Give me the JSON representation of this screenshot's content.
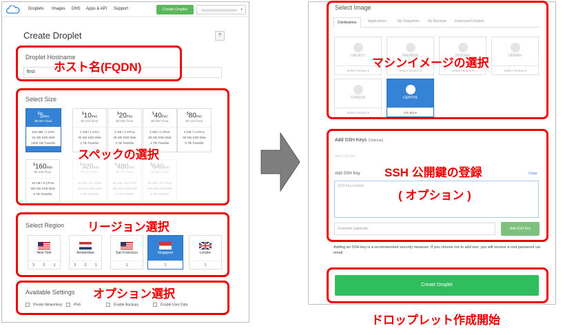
{
  "nav": {
    "items": [
      "Droplets",
      "Images",
      "DNS",
      "Apps & API",
      "Support"
    ],
    "create_button": "Create Droplet"
  },
  "page_title": "Create Droplet",
  "help_label": "?",
  "hostname": {
    "label": "Droplet Hostname",
    "value": "first"
  },
  "size": {
    "label": "Select Size",
    "plans": [
      {
        "price": "5",
        "hourly": "$0.007",
        "specs": [
          "512 MB / 1 CPU",
          "20 GB SSD Disk",
          "1000 GB Transfer"
        ]
      },
      {
        "price": "10",
        "hourly": "$0.015",
        "specs": [
          "1 GB / 1 CPU",
          "30 GB SSD Disk",
          "2 TB Transfer"
        ]
      },
      {
        "price": "20",
        "hourly": "$0.030",
        "specs": [
          "2 GB / 2 CPUs",
          "40 GB SSD Disk",
          "3 TB Transfer"
        ]
      },
      {
        "price": "40",
        "hourly": "$0.060",
        "specs": [
          "4 GB / 2 CPUs",
          "60 GB SSD Disk",
          "4 TB Transfer"
        ]
      },
      {
        "price": "80",
        "hourly": "$0.119",
        "specs": [
          "8 GB / 4 CPUs",
          "80 GB SSD Disk",
          "5 TB Transfer"
        ]
      },
      {
        "price": "160",
        "hourly": "$0.238",
        "specs": [
          "16 GB / 8 CPUs",
          "160 GB SSD Disk",
          "6 TB Transfer"
        ]
      },
      {
        "price": "320",
        "hourly": "$0.476",
        "specs": [
          "32 GB / 12 CPUs",
          "320 GB SSD Disk",
          "7 TB Transfer"
        ]
      },
      {
        "price": "480",
        "hourly": "$0.714",
        "specs": [
          "48 GB / 16 CPUs",
          "480 GB SSD Disk",
          "8 TB Transfer"
        ]
      },
      {
        "price": "640",
        "hourly": "$0.952",
        "specs": [
          "64 GB / 20 CPUs",
          "640 GB SSD Disk",
          "9 TB Transfer"
        ]
      }
    ],
    "per_month": "/mo",
    "per_hour": "/hour"
  },
  "region": {
    "label": "Select Region",
    "items": [
      {
        "name": "New York",
        "nums": [
          "3",
          "2",
          "1"
        ]
      },
      {
        "name": "Amsterdam",
        "nums": [
          "3",
          "2",
          "1"
        ]
      },
      {
        "name": "San Francisco",
        "nums": [
          "1"
        ]
      },
      {
        "name": "Singapore",
        "nums": [
          "1"
        ]
      },
      {
        "name": "London",
        "nums": [
          "1"
        ]
      }
    ]
  },
  "settings": {
    "label": "Available Settings",
    "options": [
      "Private Networking",
      "IPv6",
      "Enable Backups",
      "Enable User Data"
    ]
  },
  "image": {
    "label": "Select Image",
    "tabs": [
      "Distributions",
      "Applications",
      "My Snapshots",
      "My Backups",
      "Destroyed Droplets"
    ],
    "items": [
      {
        "name": "UBUNTU",
        "version": "Select Version ▾"
      },
      {
        "name": "FREEBSD",
        "version": "Select Version ▾"
      },
      {
        "name": "FEDORA",
        "version": "Select Version ▾"
      },
      {
        "name": "DEBIAN",
        "version": "Select Version ▾"
      },
      {
        "name": "COREOS",
        "version": "Select Version ▾"
      },
      {
        "name": "CENTOS",
        "version": "6.5 x64 ▾"
      }
    ]
  },
  "ssh": {
    "title": "Add SSH Keys",
    "optional": "(Optional)",
    "add_new": "Add SSH key",
    "field_label": "Add SSH Key",
    "close": "Close",
    "key_placeholder": "SSH Key content",
    "comment_placeholder": "Comment (optional)",
    "add_button": "Add SSH Key",
    "note": "Adding an SSH key is a recommended security measure. If you choose not to add one, you will receive a root password via email."
  },
  "create_button": "Create Droplet",
  "annotations": {
    "hostname": "ホスト名(FQDN)",
    "size": "スペックの選択",
    "region": "リージョン選択",
    "settings": "オプション選択",
    "image": "マシンイメージの選択",
    "ssh1": "SSH 公開鍵の登録",
    "ssh2": "( オプション )",
    "create": "ドロップレット作成開始"
  },
  "colors": {
    "accent": "#3583d7",
    "create": "#2fbd5d",
    "annotation": "#e00000"
  }
}
